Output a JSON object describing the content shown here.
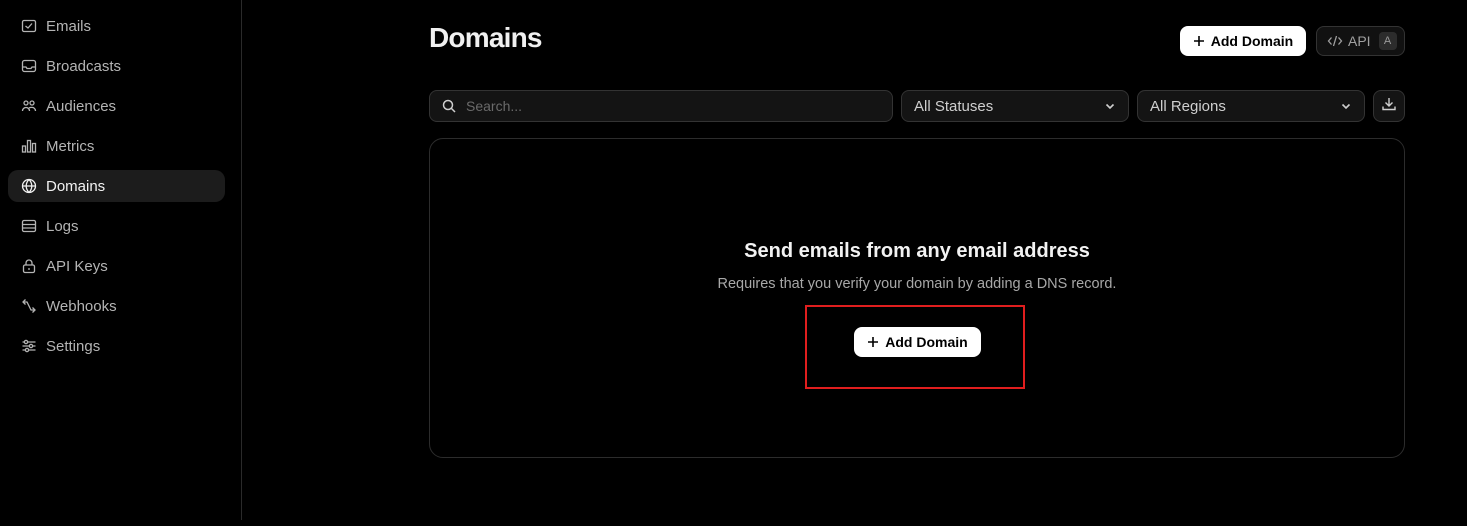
{
  "sidebar": {
    "items": [
      {
        "label": "Emails",
        "icon": "mail-icon"
      },
      {
        "label": "Broadcasts",
        "icon": "inbox-icon"
      },
      {
        "label": "Audiences",
        "icon": "users-icon"
      },
      {
        "label": "Metrics",
        "icon": "bar-chart-icon"
      },
      {
        "label": "Domains",
        "icon": "globe-icon",
        "active": true
      },
      {
        "label": "Logs",
        "icon": "logs-icon"
      },
      {
        "label": "API Keys",
        "icon": "lock-icon"
      },
      {
        "label": "Webhooks",
        "icon": "webhook-icon"
      },
      {
        "label": "Settings",
        "icon": "sliders-icon"
      }
    ]
  },
  "header": {
    "title": "Domains",
    "add_button_label": "Add Domain",
    "api_button_label": "API",
    "api_shortcut": "A"
  },
  "filters": {
    "search_placeholder": "Search...",
    "status_select": "All Statuses",
    "region_select": "All Regions"
  },
  "empty_state": {
    "title": "Send emails from any email address",
    "subtitle": "Requires that you verify your domain by adding a DNS record.",
    "button_label": "Add Domain"
  },
  "colors": {
    "background": "#000000",
    "highlight": "#e01e1e",
    "primary_button": "#ffffff"
  }
}
